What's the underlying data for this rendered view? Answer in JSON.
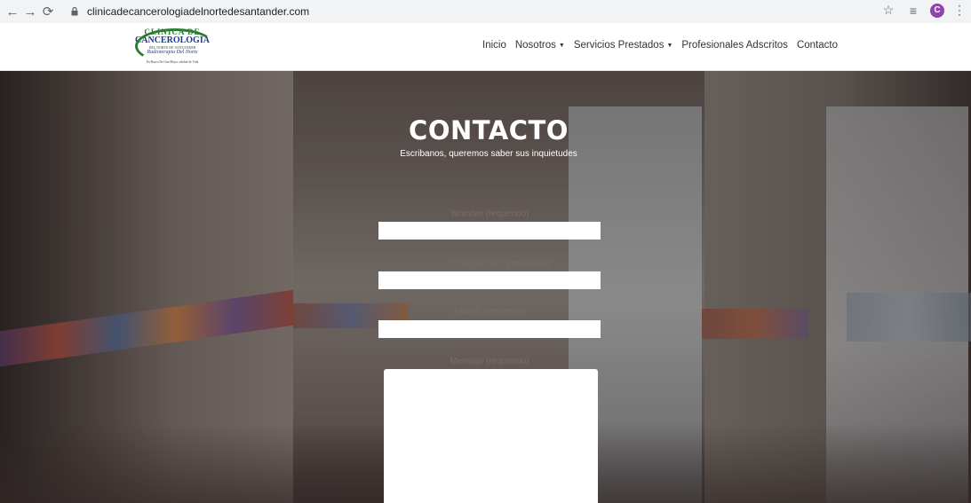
{
  "browser": {
    "url": "clinicadecancerologiadelnortedesantander.com",
    "profile_initial": "C"
  },
  "logo": {
    "line1": "CLINICA DE",
    "line2": "CANCEROLOGIA",
    "line3": "DEL NORTE DE SANTANDER",
    "line4": "Radioterapia Del Norte",
    "tagline": "En Busca De Una Mejor calidad de Vida"
  },
  "nav": {
    "items": [
      {
        "label": "Inicio",
        "has_dropdown": false
      },
      {
        "label": "Nosotros",
        "has_dropdown": true
      },
      {
        "label": "Servicios Prestados",
        "has_dropdown": true
      },
      {
        "label": "Profesionales Adscritos",
        "has_dropdown": false
      },
      {
        "label": "Contacto",
        "has_dropdown": false
      }
    ]
  },
  "hero": {
    "title": "CONTACTO",
    "subtitle": "Escribanos, queremos saber sus inquietudes"
  },
  "form": {
    "name_label": "Nombre (requerido)",
    "email_label": "o electrónico (requerido)",
    "subject_label": "Asunto (requerido)",
    "message_label": "Mensaje (requerido)"
  }
}
